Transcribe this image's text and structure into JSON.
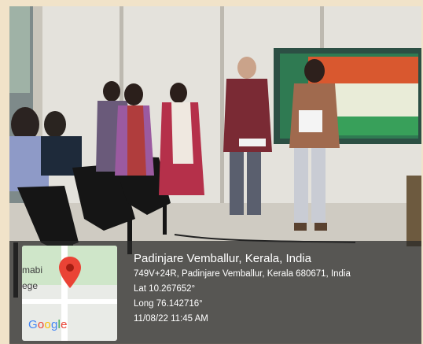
{
  "location": {
    "title": "Padinjare Vemballur, Kerala, India",
    "address": "749V+24R, Padinjare Vemballur, Kerala 680671, India",
    "latitude": "Lat 10.267652°",
    "longitude": "Long 76.142716°",
    "datetime": "11/08/22 11:45 AM"
  },
  "map": {
    "place_label_1": "mabi",
    "place_label_2": "ege",
    "logo_letters": [
      "G",
      "o",
      "o",
      "g",
      "l",
      "e"
    ],
    "logo_colors": [
      "#4285F4",
      "#EA4335",
      "#FBBC05",
      "#4285F4",
      "#34A853",
      "#EA4335"
    ],
    "pin_color": "#EA4335"
  }
}
